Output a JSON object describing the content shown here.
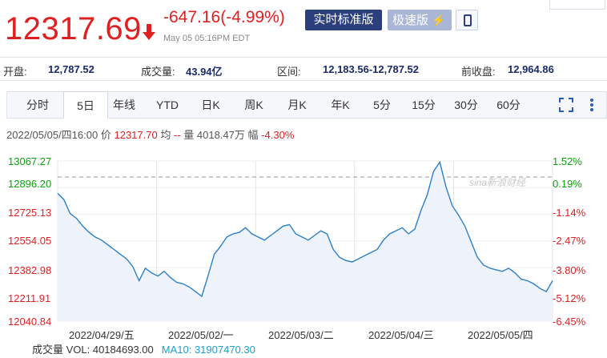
{
  "header": {
    "price": "12317.69",
    "change": "-647.16(-4.99%)",
    "time": "May 05 05:16PM EDT",
    "btn_realtime": "实时标准版",
    "btn_fast": "极速版",
    "colors": {
      "down": "#e02020",
      "up": "#0aa30a",
      "brand": "#2a3f7c"
    }
  },
  "stats": {
    "open_label": "开盘:",
    "open": "12,787.52",
    "volume_label": "成交量:",
    "volume": "43.94亿",
    "range_label": "区间:",
    "range": "12,183.56-12,787.52",
    "prev_label": "前收盘:",
    "prev": "12,964.86"
  },
  "tabs": [
    "分时",
    "5日",
    "年线",
    "YTD",
    "日K",
    "周K",
    "月K",
    "年K",
    "5分",
    "15分",
    "30分",
    "60分"
  ],
  "active_tab": "5日",
  "info": {
    "datetime": "2022/05/05/四16:00",
    "price_label": "价",
    "price": "12317.70",
    "avg_label": "均",
    "avg": "--",
    "vol_label": "量",
    "vol": "4018.47万",
    "amp_label": "幅",
    "amp": "-4.30%"
  },
  "chart_data": {
    "type": "line",
    "y_left": [
      "13067.27",
      "12896.20",
      "12725.13",
      "12554.05",
      "12382.98",
      "12211.91",
      "12040.84"
    ],
    "y_right": [
      "1.52%",
      "0.19%",
      "-1.14%",
      "-2.47%",
      "-3.80%",
      "-5.12%",
      "-6.45%"
    ],
    "x_labels": [
      "2022/04/29/五",
      "2022/05/02/一",
      "2022/05/03/二",
      "2022/05/04/三",
      "2022/05/05/四"
    ],
    "ylim": [
      12040.84,
      13067.27
    ],
    "prev_close": 12964.86,
    "series": [
      {
        "values": [
          12860,
          12820,
          12730,
          12700,
          12650,
          12610,
          12580,
          12560,
          12530,
          12500,
          12470,
          12440,
          12390,
          12300,
          12380,
          12350,
          12330,
          12360,
          12320,
          12290,
          12280,
          12260,
          12230,
          12200,
          12330,
          12470,
          12520,
          12580,
          12600,
          12610,
          12640,
          12600,
          12580,
          12560,
          12590,
          12620,
          12650,
          12660,
          12600,
          12580,
          12560,
          12590,
          12620,
          12600,
          12500,
          12450,
          12430,
          12420,
          12440,
          12460,
          12480,
          12500,
          12560,
          12600,
          12620,
          12640,
          12600,
          12630,
          12750,
          12850,
          13000,
          13060,
          12900,
          12780,
          12720,
          12650,
          12550,
          12450,
          12400,
          12380,
          12370,
          12360,
          12380,
          12350,
          12310,
          12300,
          12280,
          12250,
          12230,
          12300
        ]
      }
    ]
  },
  "volume_row": {
    "label": "成交量 VOL: 40184693.00",
    "ma10": "MA10: 31907470.30"
  },
  "watermark": "sina新浪财经"
}
